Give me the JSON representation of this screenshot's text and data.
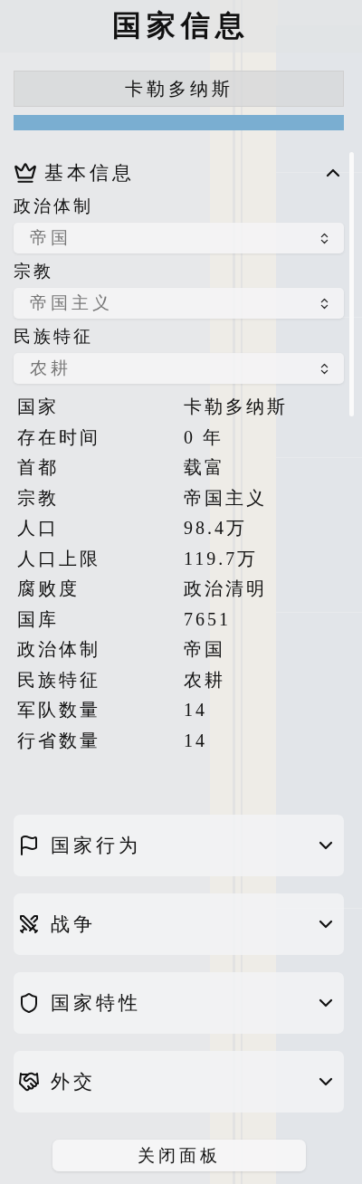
{
  "title": "国家信息",
  "country_name": "卡勒多纳斯",
  "progress": {
    "level": 1
  },
  "sections": [
    {
      "title": "基本信息",
      "expanded": true,
      "fields": [
        {
          "label": "政治体制",
          "value": "帝国"
        },
        {
          "label": "宗教",
          "value": "帝国主义"
        },
        {
          "label": "民族特征",
          "value": "农耕"
        }
      ],
      "rows": [
        {
          "label": "国家",
          "value": "卡勒多纳斯"
        },
        {
          "label": "存在时间",
          "value": "0 年"
        },
        {
          "label": "首都",
          "value": "载富"
        },
        {
          "label": "宗教",
          "value": "帝国主义"
        },
        {
          "label": "人口",
          "value": "98.4万"
        },
        {
          "label": "人口上限",
          "value": "119.7万"
        },
        {
          "label": "腐败度",
          "value": "政治清明"
        },
        {
          "label": "国库",
          "value": "7651"
        },
        {
          "label": "政治体制",
          "value": "帝国"
        },
        {
          "label": "民族特征",
          "value": "农耕"
        },
        {
          "label": "军队数量",
          "value": "14"
        },
        {
          "label": "行省数量",
          "value": "14"
        }
      ]
    },
    {
      "title": "国家行为",
      "expanded": false
    },
    {
      "title": "战争",
      "expanded": false
    },
    {
      "title": "国家特性",
      "expanded": false
    },
    {
      "title": "外交",
      "expanded": false
    }
  ],
  "close_button": "关闭面板"
}
